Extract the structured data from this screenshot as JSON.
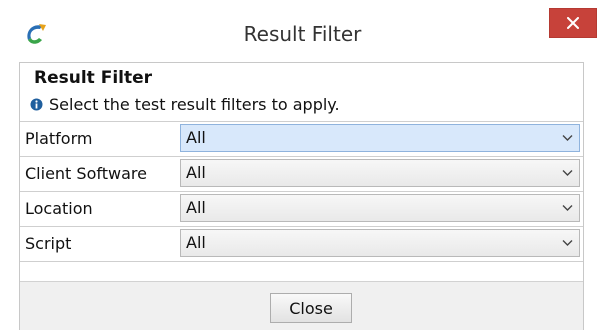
{
  "window": {
    "title": "Result Filter",
    "app_icon": "refresh-logo-icon",
    "close_icon": "close-x-icon"
  },
  "dialog": {
    "heading": "Result Filter",
    "info_icon": "info-icon",
    "info_text": "Select the test result filters to apply."
  },
  "filters": [
    {
      "label": "Platform",
      "value": "All",
      "focused": true
    },
    {
      "label": "Client Software",
      "value": "All",
      "focused": false
    },
    {
      "label": "Location",
      "value": "All",
      "focused": false
    },
    {
      "label": "Script",
      "value": "All",
      "focused": false
    }
  ],
  "footer": {
    "close_label": "Close"
  },
  "colors": {
    "close_button_bg": "#c7423a",
    "focused_select_bg": "#d8e8fb",
    "info_icon": "#1f5f9e"
  }
}
